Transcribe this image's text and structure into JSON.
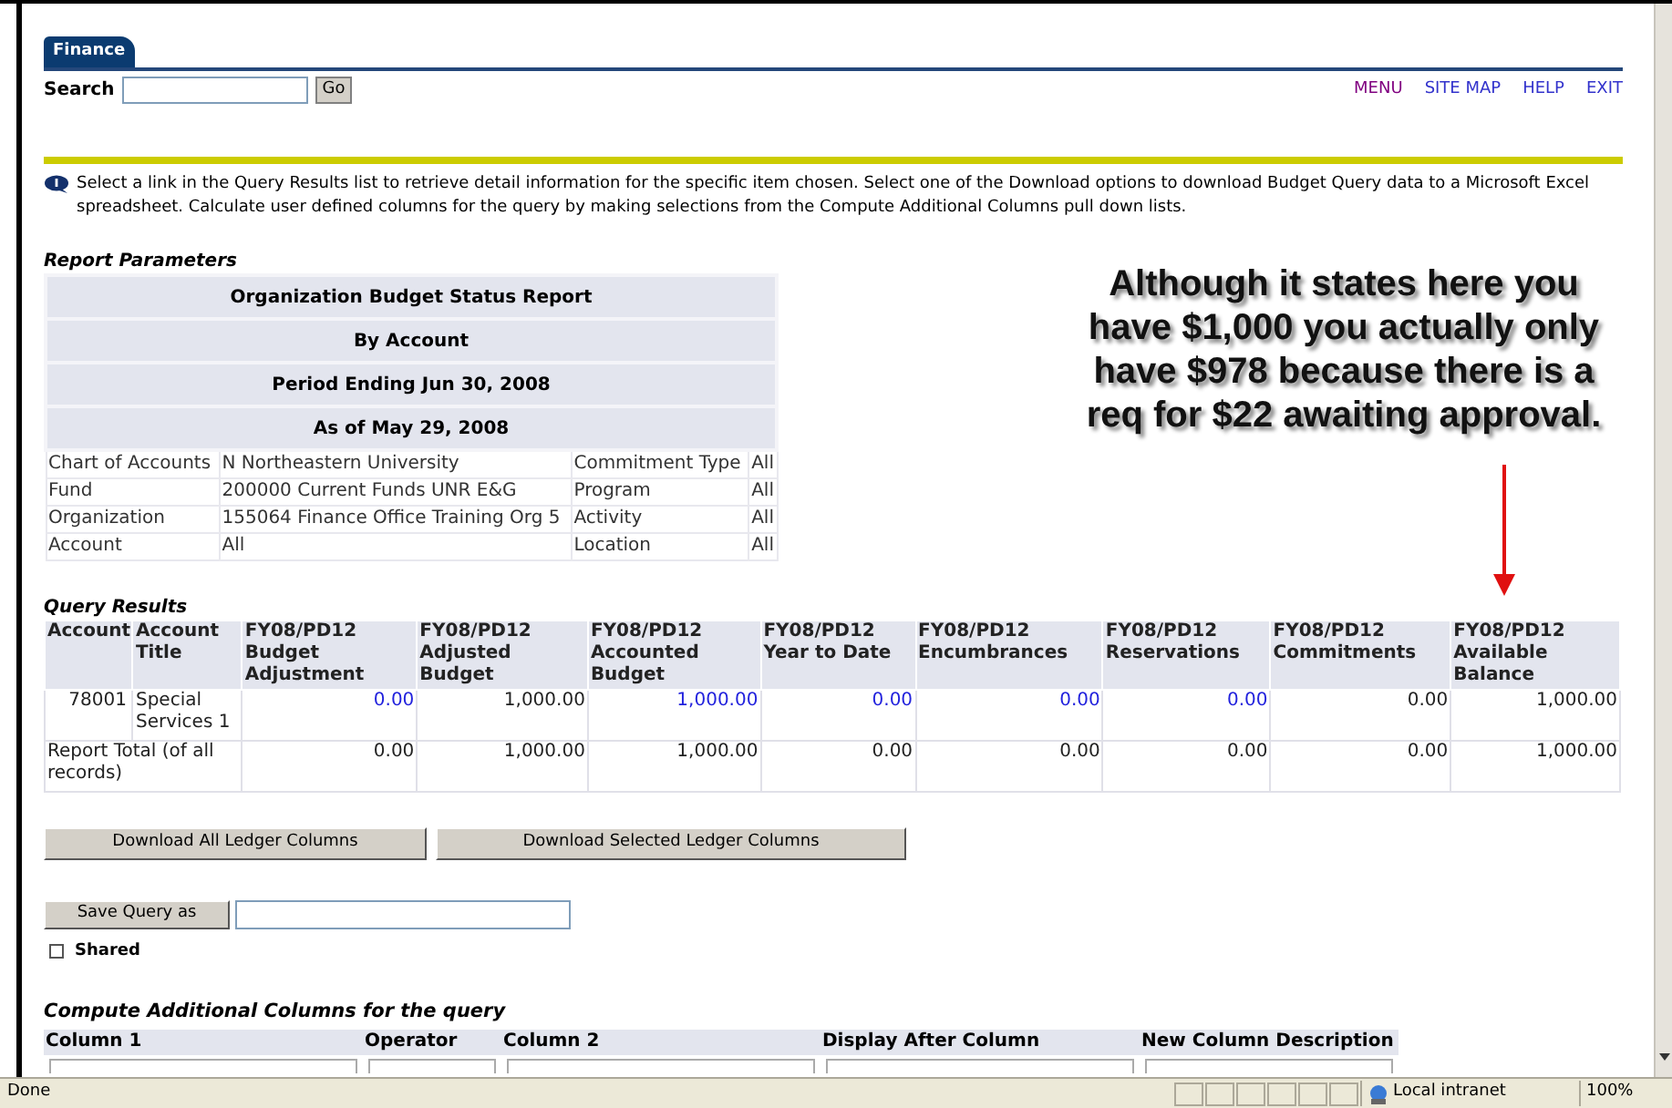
{
  "tabs": [
    {
      "label": "Finance",
      "selected": true
    }
  ],
  "search": {
    "label": "Search",
    "button": "Go"
  },
  "top_links": [
    "MENU",
    "SITE MAP",
    "HELP",
    "EXIT"
  ],
  "info_text": "Select a link in the Query Results list to retrieve detail information for the specific item chosen. Select one of the Download options to download Budget Query data to a Microsoft Excel spreadsheet. Calculate user defined columns for the query by making selections from the Compute Additional Columns pull down lists.",
  "report_parameters": {
    "title": "Report Parameters",
    "headings": [
      "Organization Budget Status Report",
      "By Account",
      "Period Ending Jun 30, 2008",
      "As of May 29, 2008"
    ],
    "rows": [
      [
        "Chart of Accounts",
        "N Northeastern University",
        "Commitment Type",
        "All"
      ],
      [
        "Fund",
        "200000 Current Funds UNR E&G",
        "Program",
        "All"
      ],
      [
        "Organization",
        "155064 Finance Office Training Org 5",
        "Activity",
        "All"
      ],
      [
        "Account",
        "All",
        "Location",
        "All"
      ]
    ]
  },
  "annotation": "Although it states here you have $1,000 you actually only have $978 because there is a req for $22 awaiting approval.",
  "query_results": {
    "title": "Query Results",
    "columns": [
      "Account",
      "Account Title",
      "FY08/PD12 Budget Adjustment",
      "FY08/PD12 Adjusted Budget",
      "FY08/PD12 Accounted Budget",
      "FY08/PD12 Year to Date",
      "FY08/PD12 Encumbrances",
      "FY08/PD12 Reservations",
      "FY08/PD12 Commitments",
      "FY08/PD12 Available Balance"
    ],
    "rows": [
      {
        "kind": "account",
        "cells": [
          {
            "text": "78001",
            "link": false
          },
          {
            "text": "Special Services 1",
            "link": false
          },
          {
            "text": "0.00",
            "link": true
          },
          {
            "text": "1,000.00",
            "link": false
          },
          {
            "text": "1,000.00",
            "link": true
          },
          {
            "text": "0.00",
            "link": true
          },
          {
            "text": "0.00",
            "link": true
          },
          {
            "text": "0.00",
            "link": true
          },
          {
            "text": "0.00",
            "link": false
          },
          {
            "text": "1,000.00",
            "link": false
          }
        ]
      },
      {
        "kind": "total",
        "cells": [
          {
            "text": "Report Total (of all records)",
            "link": false,
            "colspan": 2
          },
          {
            "text": "0.00",
            "link": false
          },
          {
            "text": "1,000.00",
            "link": false
          },
          {
            "text": "1,000.00",
            "link": false
          },
          {
            "text": "0.00",
            "link": false
          },
          {
            "text": "0.00",
            "link": false
          },
          {
            "text": "0.00",
            "link": false
          },
          {
            "text": "0.00",
            "link": false
          },
          {
            "text": "1,000.00",
            "link": false
          }
        ]
      }
    ]
  },
  "download_buttons": [
    "Download All Ledger Columns",
    "Download Selected Ledger Columns"
  ],
  "save_query": {
    "button": "Save Query as",
    "shared": {
      "label": "Shared",
      "checked": false
    }
  },
  "compute": {
    "title": "Compute Additional Columns for the query",
    "columns": [
      "Column 1",
      "Operator",
      "Column 2",
      "Display After Column",
      "New Column Description"
    ]
  },
  "status_bar": {
    "status": "Done",
    "zone": "Local intranet",
    "zoom": "100%"
  }
}
